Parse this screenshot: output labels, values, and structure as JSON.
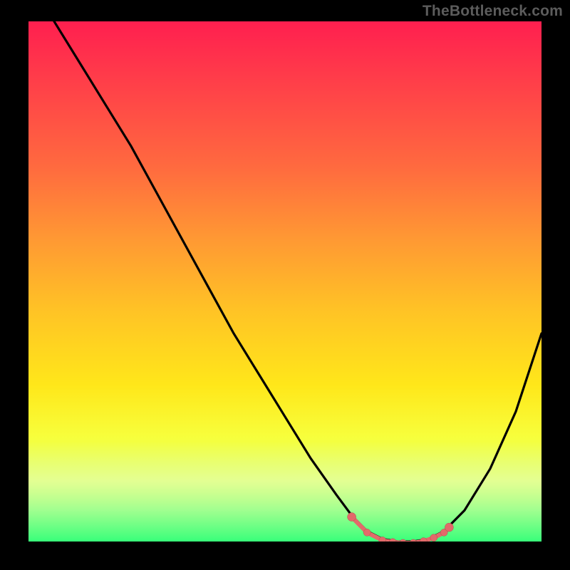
{
  "watermark": "TheBottleneck.com",
  "chart_data": {
    "type": "line",
    "title": "",
    "xlabel": "",
    "ylabel": "",
    "xlim": [
      0,
      100
    ],
    "ylim": [
      0,
      100
    ],
    "grid": false,
    "legend": false,
    "gradient_stops": [
      {
        "pos": 0,
        "color": "#ff1f4f"
      },
      {
        "pos": 28,
        "color": "#ff6a3f"
      },
      {
        "pos": 56,
        "color": "#ffc425"
      },
      {
        "pos": 80,
        "color": "#f7ff3c"
      },
      {
        "pos": 94,
        "color": "#94ff86"
      },
      {
        "pos": 100,
        "color": "#38ff7a"
      }
    ],
    "series": [
      {
        "name": "bottleneck-curve",
        "x": [
          5,
          10,
          15,
          20,
          25,
          30,
          35,
          40,
          45,
          50,
          55,
          60,
          63,
          66,
          69,
          72,
          75,
          78,
          81,
          85,
          90,
          95,
          100
        ],
        "y": [
          100,
          92,
          84,
          76,
          67,
          58,
          49,
          40,
          32,
          24,
          16,
          9,
          5,
          2,
          0.5,
          0,
          0,
          0.5,
          2,
          6,
          14,
          25,
          40
        ]
      }
    ],
    "highlight_range": {
      "x_start": 63,
      "x_end": 82
    },
    "highlight_dots_x": [
      63,
      66,
      69,
      71,
      73,
      75,
      77,
      79,
      81,
      82
    ]
  }
}
